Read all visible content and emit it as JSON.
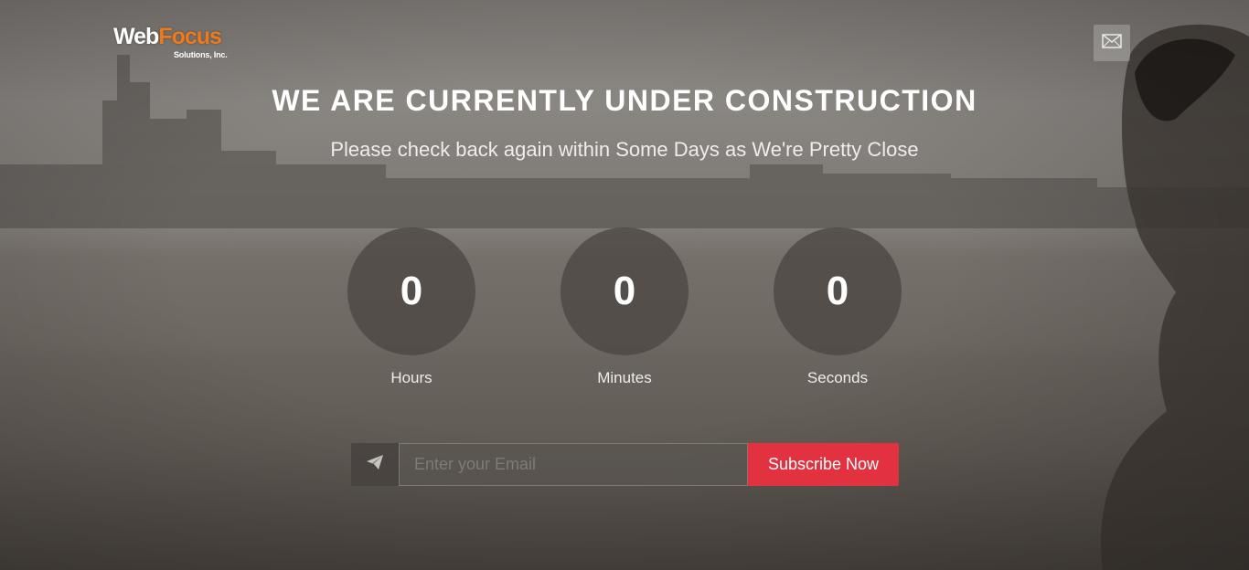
{
  "logo": {
    "main_part1": "Web",
    "main_part2": "Focus",
    "sub": "Solutions, Inc."
  },
  "header": {
    "mail_icon": "envelope-icon"
  },
  "hero": {
    "title": "WE ARE CURRENTLY UNDER CONSTRUCTION",
    "subtitle": "Please check back again within Some Days as We're Pretty Close"
  },
  "countdown": [
    {
      "value": "0",
      "label": "Hours"
    },
    {
      "value": "0",
      "label": "Minutes"
    },
    {
      "value": "0",
      "label": "Seconds"
    }
  ],
  "subscribe": {
    "icon": "paper-plane-icon",
    "placeholder": "Enter your Email",
    "value": "",
    "button_label": "Subscribe Now"
  },
  "colors": {
    "accent_red": "#e2313f",
    "logo_orange": "#f07a1a"
  }
}
